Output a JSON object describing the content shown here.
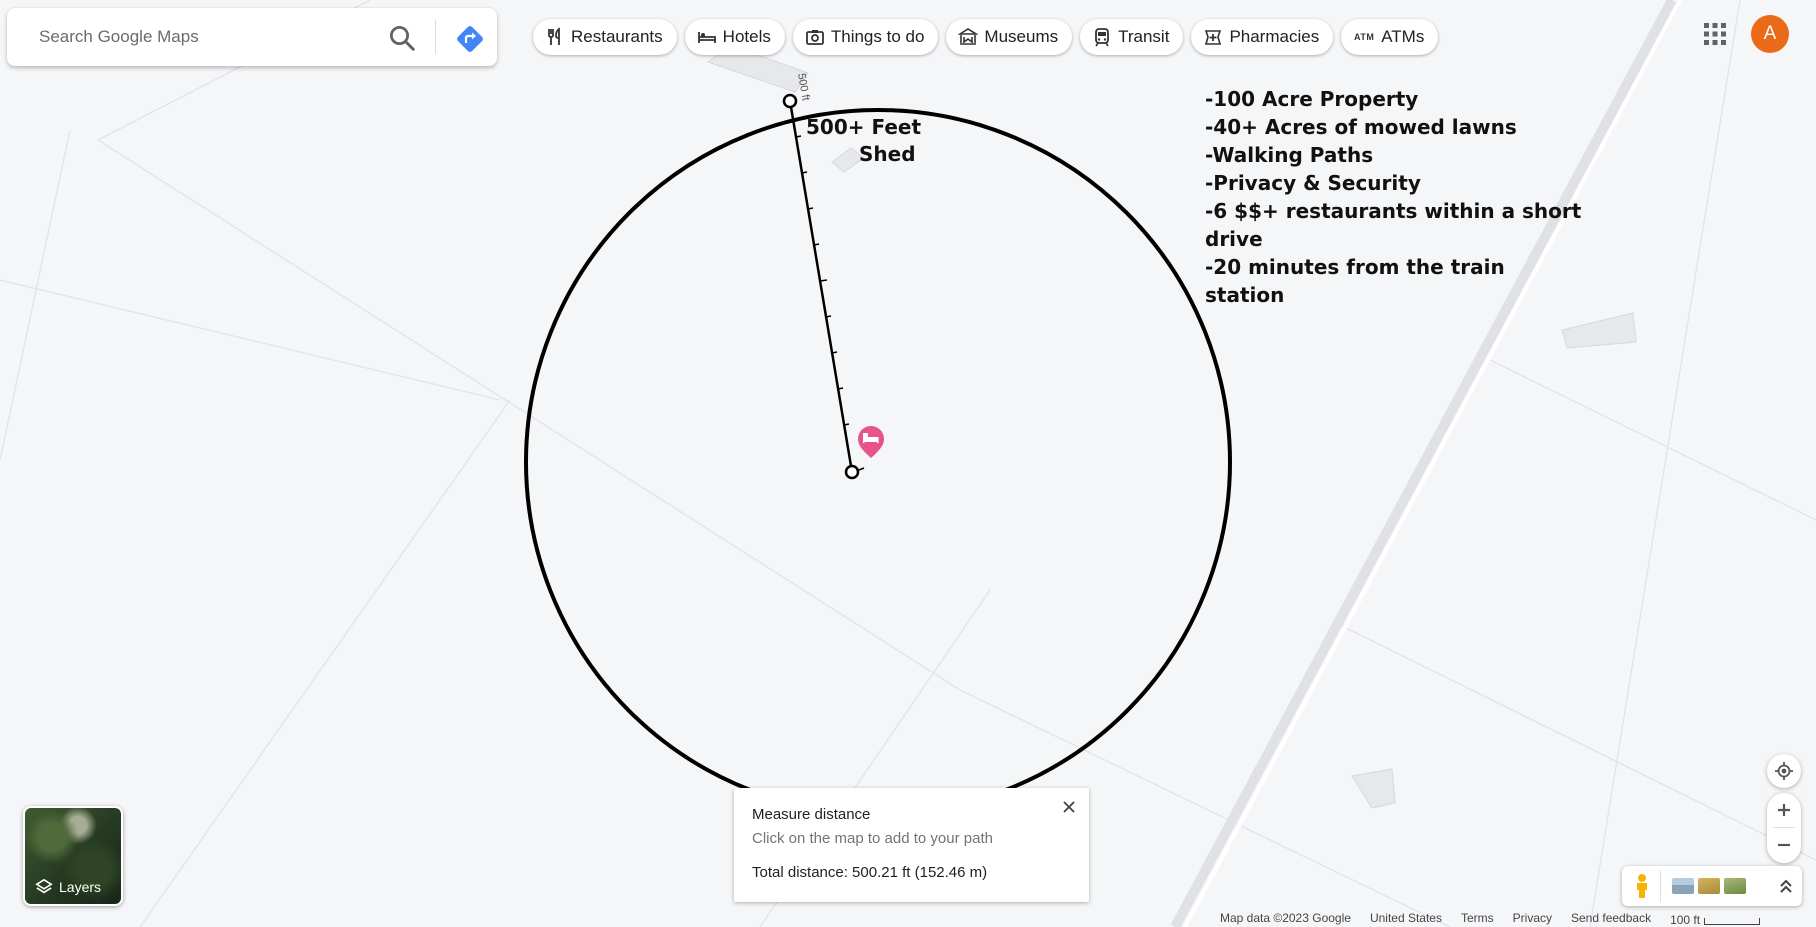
{
  "search": {
    "placeholder": "Search Google Maps"
  },
  "chips": [
    {
      "label": "Restaurants",
      "icon": "restaurant-icon"
    },
    {
      "label": "Hotels",
      "icon": "hotel-icon"
    },
    {
      "label": "Things to do",
      "icon": "camera-icon"
    },
    {
      "label": "Museums",
      "icon": "museum-icon"
    },
    {
      "label": "Transit",
      "icon": "transit-icon"
    },
    {
      "label": "Pharmacies",
      "icon": "pharmacy-icon"
    },
    {
      "label": "ATMs",
      "icon": "atm-icon",
      "glyph": "ATM"
    }
  ],
  "account": {
    "avatar_letter": "A",
    "avatar_color": "#ea6a17"
  },
  "annotations": {
    "distance_label": "500+ Feet",
    "shed_label": "Shed",
    "ruler_label": "500 ft",
    "notes": [
      "-100 Acre Property",
      "-40+ Acres of mowed lawns",
      "-Walking Paths",
      "-Privacy & Security",
      "-6 $$+  restaurants within a short",
      "drive",
      "-20 minutes from the train",
      "station"
    ]
  },
  "measure": {
    "title": "Measure distance",
    "hint": "Click on the map to add to your path",
    "total": "Total distance: 500.21 ft (152.46 m)"
  },
  "layers": {
    "label": "Layers"
  },
  "footer": {
    "map_data": "Map data ©2023 Google",
    "region": "United States",
    "terms": "Terms",
    "privacy": "Privacy",
    "feedback": "Send feedback",
    "scale": "100 ft"
  },
  "colors": {
    "accent": "#4285f4",
    "pin": "#e8538a",
    "background": "#f5f6f8"
  }
}
